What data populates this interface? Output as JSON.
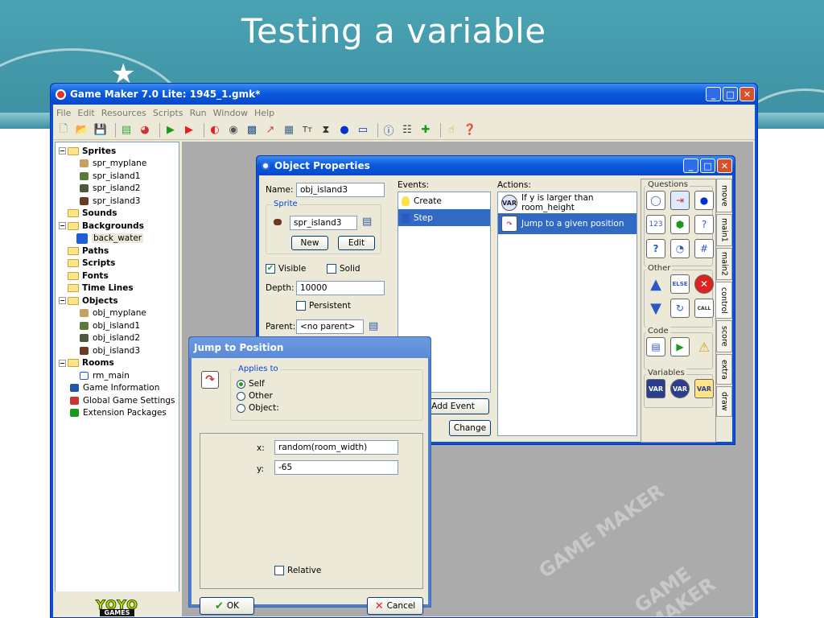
{
  "slide": {
    "title": "Testing a variable"
  },
  "window": {
    "title": "Game Maker 7.0 Lite: 1945_1.gmk*",
    "menu": [
      "File",
      "Edit",
      "Resources",
      "Scripts",
      "Run",
      "Window",
      "Help"
    ]
  },
  "tree": {
    "items": [
      {
        "label": "Sprites",
        "bold": true,
        "exp": "⊟"
      },
      {
        "label": "spr_myplane"
      },
      {
        "label": "spr_island1"
      },
      {
        "label": "spr_island2"
      },
      {
        "label": "spr_island3"
      },
      {
        "label": "Sounds",
        "bold": true
      },
      {
        "label": "Backgrounds",
        "bold": true,
        "exp": "⊟"
      },
      {
        "label": "back_water"
      },
      {
        "label": "Paths",
        "bold": true
      },
      {
        "label": "Scripts",
        "bold": true
      },
      {
        "label": "Fonts",
        "bold": true
      },
      {
        "label": "Time Lines",
        "bold": true
      },
      {
        "label": "Objects",
        "bold": true,
        "exp": "⊟"
      },
      {
        "label": "obj_myplane"
      },
      {
        "label": "obj_island1"
      },
      {
        "label": "obj_island2"
      },
      {
        "label": "obj_island3"
      },
      {
        "label": "Rooms",
        "bold": true,
        "exp": "⊟"
      },
      {
        "label": "rm_main"
      },
      {
        "label": "Game Information"
      },
      {
        "label": "Global Game Settings"
      },
      {
        "label": "Extension Packages"
      }
    ],
    "logo": "YOYO",
    "logo_sub": "GAMES"
  },
  "watermark": "GAME MAKER",
  "object_properties": {
    "title": "Object Properties",
    "name_label": "Name:",
    "name_value": "obj_island3",
    "sprite_group": "Sprite",
    "sprite_value": "spr_island3",
    "new_button": "New",
    "edit_button": "Edit",
    "visible_label": "Visible",
    "solid_label": "Solid",
    "depth_label": "Depth:",
    "depth_value": "10000",
    "persistent_label": "Persistent",
    "parent_label": "Parent:",
    "parent_value": "<no parent>",
    "events_label": "Events:",
    "events": [
      "Create",
      "Step"
    ],
    "add_event_button": "Add Event",
    "change_button": "Change",
    "actions_label": "Actions:",
    "actions": [
      {
        "text": "If y is larger than room_height",
        "icon": "VAR"
      },
      {
        "text": "Jump to a given position",
        "icon": "jump"
      }
    ],
    "palette": {
      "questions_label": "Questions",
      "other_label": "Other",
      "code_label": "Code",
      "variables_label": "Variables",
      "tabs": [
        "move",
        "main1",
        "main2",
        "control",
        "score",
        "extra",
        "draw"
      ]
    }
  },
  "jump_dialog": {
    "title": "Jump to Position",
    "applies_to_label": "Applies to",
    "self_label": "Self",
    "other_label": "Other",
    "object_label": "Object:",
    "x_label": "x:",
    "x_value": "random(room_width)",
    "y_label": "y:",
    "y_value": "-65",
    "relative_label": "Relative",
    "ok_button": "OK",
    "cancel_button": "Cancel"
  }
}
